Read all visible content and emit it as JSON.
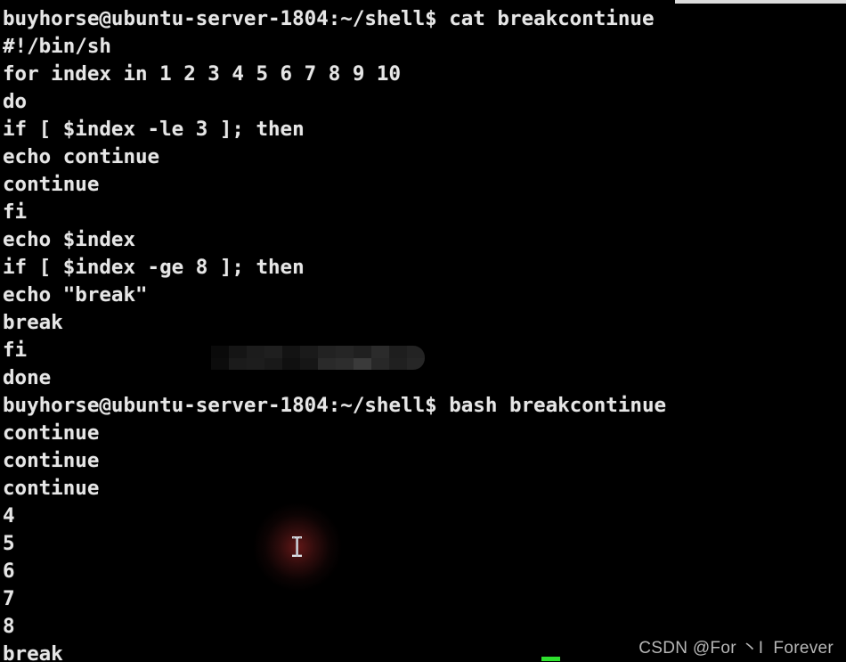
{
  "terminal": {
    "background_color": "#000000",
    "text_color": "#e6e6e6",
    "lines": [
      "buyhorse@ubuntu-server-1804:~/shell$ cat breakcontinue",
      "#!/bin/sh",
      "for index in 1 2 3 4 5 6 7 8 9 10",
      "do",
      "if [ $index -le 3 ]; then",
      "echo continue",
      "continue",
      "fi",
      "echo $index",
      "if [ $index -ge 8 ]; then",
      "echo \"break\"",
      "break",
      "fi",
      "done",
      "buyhorse@ubuntu-server-1804:~/shell$ bash breakcontinue",
      "continue",
      "continue",
      "continue",
      "4",
      "5",
      "6",
      "7",
      "8",
      "break"
    ],
    "prompt_user": "buyhorse",
    "prompt_host": "ubuntu-server-1804",
    "prompt_path": "~/shell",
    "prompt_symbol": "$",
    "commands": [
      "cat breakcontinue",
      "bash breakcontinue"
    ],
    "script_name": "breakcontinue"
  },
  "overlays": {
    "redaction_label": "pixelated-redaction-block",
    "green_indicator_color": "#2ee02e",
    "top_bar_color": "#dcdcdc",
    "cursor_glow_color": "#701a1a",
    "cursor_type": "i-beam-text-cursor"
  },
  "watermark": {
    "text": "CSDN @For 丶I  Forever",
    "color": "#b7b7b7"
  }
}
